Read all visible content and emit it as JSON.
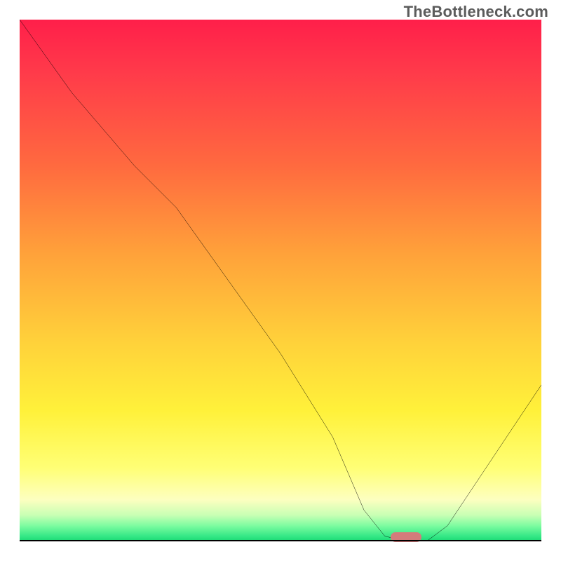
{
  "watermark": "TheBottleneck.com",
  "chart_data": {
    "type": "line",
    "title": "",
    "xlabel": "",
    "ylabel": "",
    "xlim": [
      0,
      100
    ],
    "ylim": [
      0,
      100
    ],
    "x": [
      0,
      10,
      22,
      30,
      40,
      50,
      60,
      66,
      70,
      74,
      78,
      82,
      100
    ],
    "values": [
      100,
      86,
      72,
      64,
      50,
      36,
      20,
      6,
      1,
      0,
      0,
      3,
      30
    ],
    "marker": {
      "x": 74,
      "y": 0.8
    },
    "background_gradient": {
      "orientation": "vertical",
      "stops": [
        {
          "pos": 0.0,
          "color": "#ff1f4a"
        },
        {
          "pos": 0.45,
          "color": "#ffa23a"
        },
        {
          "pos": 0.75,
          "color": "#fff13a"
        },
        {
          "pos": 0.95,
          "color": "#c8ffb4"
        },
        {
          "pos": 1.0,
          "color": "#19d873"
        }
      ]
    }
  }
}
